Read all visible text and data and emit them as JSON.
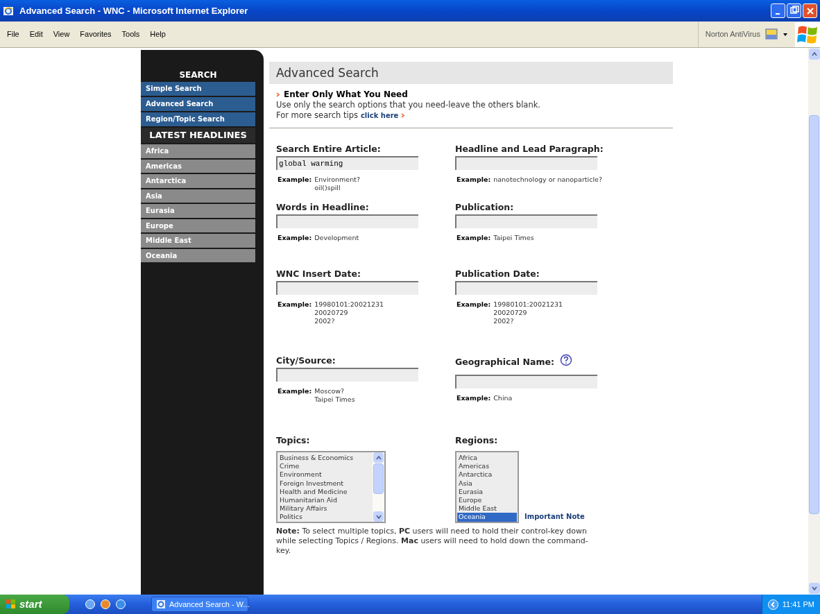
{
  "window": {
    "title": "Advanced Search - WNC - Microsoft Internet Explorer"
  },
  "menu": [
    "File",
    "Edit",
    "View",
    "Favorites",
    "Tools",
    "Help"
  ],
  "toolbar": {
    "norton": "Norton AntiVirus"
  },
  "sidebar": {
    "search_heading": "SEARCH",
    "search_links": [
      "Simple Search",
      "Advanced Search",
      "Region/Topic Search"
    ],
    "headlines_heading": "LATEST HEADLINES",
    "headline_links": [
      "Africa",
      "Americas",
      "Antarctica",
      "Asia",
      "Eurasia",
      "Europe",
      "Middle East",
      "Oceania"
    ]
  },
  "content": {
    "title": "Advanced Search",
    "tip_heading": "Enter Only What You Need",
    "tip_text": "Use only the search options that you need-leave the others blank.",
    "tip_more": "For more search tips",
    "tip_link": "click here",
    "fields": [
      {
        "label": "Search Entire Article:",
        "value": "global warming",
        "help": false,
        "example_label": "Example:",
        "example_lines": [
          "Environment?",
          "oil()spill"
        ]
      },
      {
        "label": "Headline and Lead Paragraph:",
        "help": false,
        "example_label": "Example:",
        "example_lines": [
          "nanotechnology or nanoparticle?"
        ]
      },
      {
        "label": "Words in Headline:",
        "help": false,
        "example_label": "Example:",
        "example_lines": [
          "Development"
        ]
      },
      {
        "label": "Publication:",
        "help": false,
        "example_label": "Example:",
        "example_lines": [
          "Taipei Times"
        ]
      },
      {
        "label": "WNC Insert Date:",
        "help": false,
        "example_label": "Example:",
        "example_lines": [
          "19980101:20021231",
          "20020729",
          "2002?"
        ]
      },
      {
        "label": "Publication Date:",
        "help": false,
        "example_label": "Example:",
        "example_lines": [
          "19980101:20021231",
          "20020729",
          "2002?"
        ]
      },
      {
        "label": "City/Source:",
        "help": false,
        "example_label": "Example:",
        "example_lines": [
          "Moscow?",
          "Taipei Times"
        ]
      },
      {
        "label": "Geographical Name:",
        "help": true,
        "example_label": "Example:",
        "example_lines": [
          "China"
        ]
      }
    ],
    "topics": {
      "label": "Topics:",
      "options": [
        {
          "label": "Business & Economics",
          "selected": false
        },
        {
          "label": "Crime",
          "selected": false
        },
        {
          "label": "Environment",
          "selected": false
        },
        {
          "label": "Foreign Investment",
          "selected": false
        },
        {
          "label": "Health and Medicine",
          "selected": false
        },
        {
          "label": "Humanitarian Aid",
          "selected": false
        },
        {
          "label": "Military Affairs",
          "selected": false
        },
        {
          "label": "Politics",
          "selected": false
        }
      ]
    },
    "regions": {
      "label": "Regions:",
      "options": [
        {
          "label": "Africa",
          "selected": false
        },
        {
          "label": "Americas",
          "selected": false
        },
        {
          "label": "Antarctica",
          "selected": false
        },
        {
          "label": "Asia",
          "selected": false
        },
        {
          "label": "Eurasia",
          "selected": false
        },
        {
          "label": "Europe",
          "selected": false
        },
        {
          "label": "Middle East",
          "selected": false
        },
        {
          "label": "Oceania",
          "selected": true
        }
      ]
    },
    "important_note": "Important Note",
    "note": "**Note:** To select multiple topics, **PC** users will need to hold their control-key down while selecting Topics / Regions. **Mac** users will need to hold down the command-key."
  },
  "taskbar": {
    "start": "start",
    "window_button": "Advanced Search - W...",
    "clock": "11:41 PM"
  }
}
